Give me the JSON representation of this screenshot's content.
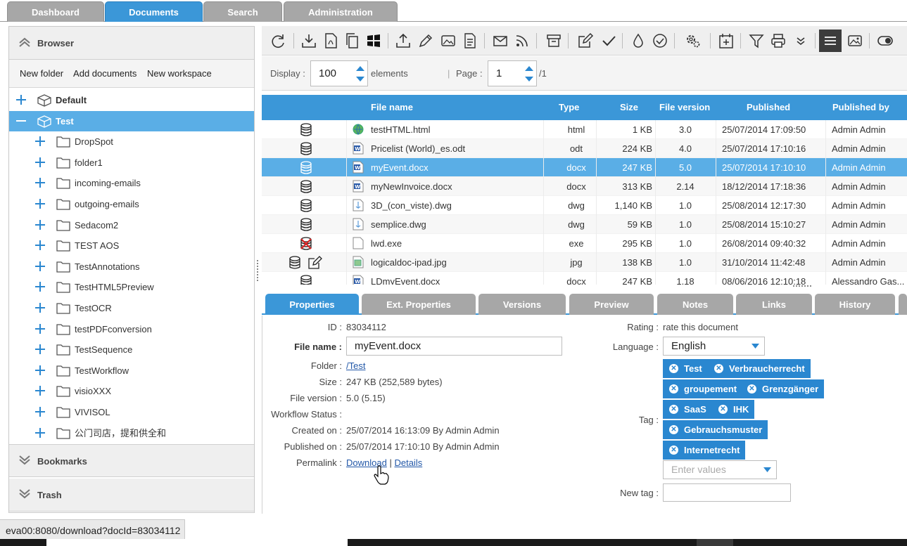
{
  "top_tabs": [
    "Dashboard",
    "Documents",
    "Search",
    "Administration"
  ],
  "left": {
    "browser_title": "Browser",
    "actions": [
      "New folder",
      "Add documents",
      "New workspace"
    ],
    "tree": [
      {
        "label": "Default",
        "level": 0,
        "bold": true
      },
      {
        "label": "Test",
        "level": 0,
        "bold": true,
        "selected": true
      },
      {
        "label": "DropSpot",
        "level": 1
      },
      {
        "label": "folder1",
        "level": 1
      },
      {
        "label": "incoming-emails",
        "level": 1
      },
      {
        "label": "outgoing-emails",
        "level": 1
      },
      {
        "label": "Sedacom2",
        "level": 1
      },
      {
        "label": "TEST AOS",
        "level": 1
      },
      {
        "label": "TestAnnotations",
        "level": 1
      },
      {
        "label": "TestHTML5Preview",
        "level": 1
      },
      {
        "label": "TestOCR",
        "level": 1
      },
      {
        "label": "testPDFconversion",
        "level": 1
      },
      {
        "label": "TestSequence",
        "level": 1
      },
      {
        "label": "TestWorkflow",
        "level": 1
      },
      {
        "label": "visioXXX",
        "level": 1
      },
      {
        "label": "VIVISOL",
        "level": 1
      },
      {
        "label": "公门司店，提和供全和",
        "level": 1
      }
    ],
    "bookmarks_title": "Bookmarks",
    "trash_title": "Trash"
  },
  "display": {
    "label": "Display :",
    "value": "100",
    "elements_label": "elements",
    "page_label": "Page :",
    "page_value": "1",
    "page_total": "/1"
  },
  "grid": {
    "columns": [
      "File name",
      "Type",
      "Size",
      "File version",
      "Published",
      "Published by"
    ],
    "rows": [
      {
        "name": "testHTML.html",
        "type": "html",
        "size": "1 KB",
        "version": "3.0",
        "published": "25/07/2014 17:09:50",
        "by": "Admin Admin",
        "icon": "html-file-icon"
      },
      {
        "name": "Pricelist (World)_es.odt",
        "type": "odt",
        "size": "224 KB",
        "version": "4.0",
        "published": "25/07/2014 17:10:16",
        "by": "Admin Admin",
        "icon": "word-file-icon"
      },
      {
        "name": "myEvent.docx",
        "type": "docx",
        "size": "247 KB",
        "version": "5.0",
        "published": "25/07/2014 17:10:10",
        "by": "Admin Admin",
        "icon": "word-file-icon",
        "selected": true
      },
      {
        "name": "myNewInvoice.docx",
        "type": "docx",
        "size": "313 KB",
        "version": "2.14",
        "published": "18/12/2014 17:18:36",
        "by": "Admin Admin",
        "icon": "word-file-icon"
      },
      {
        "name": "3D_(con_viste).dwg",
        "type": "dwg",
        "size": "1,140 KB",
        "version": "1.0",
        "published": "25/08/2014 12:17:30",
        "by": "Admin Admin",
        "icon": "dwg-file-icon"
      },
      {
        "name": "semplice.dwg",
        "type": "dwg",
        "size": "59 KB",
        "version": "1.0",
        "published": "25/08/2014 15:10:27",
        "by": "Admin Admin",
        "icon": "dwg-file-icon"
      },
      {
        "name": "lwd.exe",
        "type": "exe",
        "size": "295 KB",
        "version": "1.0",
        "published": "26/08/2014 09:40:32",
        "by": "Admin Admin",
        "icon": "generic-file-icon",
        "indexed": false
      },
      {
        "name": "logicaldoc-ipad.jpg",
        "type": "jpg",
        "size": "138 KB",
        "version": "1.0",
        "published": "31/10/2014 11:42:48",
        "by": "Admin Admin",
        "icon": "image-file-icon",
        "edit": true
      },
      {
        "name": "LDmyEvent.docx",
        "type": "docx",
        "size": "247 KB",
        "version": "1.18",
        "published": "08/06/2016 12:10:18",
        "by": "Alessandro Gas...",
        "icon": "word-file-icon"
      }
    ]
  },
  "bottom_tabs": [
    "Properties",
    "Ext. Properties",
    "Versions",
    "Preview",
    "Notes",
    "Links",
    "History"
  ],
  "properties": {
    "id_label": "ID :",
    "id": "83034112",
    "filename_label": "File name :",
    "filename": "myEvent.docx",
    "folder_label": "Folder :",
    "folder": "/Test",
    "size_label": "Size :",
    "size": "247 KB (252,589 bytes)",
    "version_label": "File version :",
    "version": "5.0 (5.15)",
    "workflow_label": "Workflow Status :",
    "created_label": "Created on :",
    "created": "25/07/2014 16:13:09 By Admin Admin",
    "published_label": "Published on :",
    "published": "25/07/2014 17:10:10 By Admin Admin",
    "permalink_label": "Permalink :",
    "download": "Download",
    "sep": "|",
    "details": "Details",
    "rating_label": "Rating :",
    "rating": "rate this document",
    "language_label": "Language :",
    "language": "English",
    "tag_label": "Tag :",
    "tags": [
      "Test",
      "Verbraucherrecht",
      "groupement",
      "Grenzgänger",
      "SaaS",
      "IHK",
      "Gebrauchsmuster",
      "Internetrecht"
    ],
    "enter_values": "Enter values",
    "newtag_label": "New tag :"
  },
  "status_url": "eva00:8080/download?docId=83034112",
  "colors": {
    "accent": "#3b97d8",
    "selected_row": "#5aaee6",
    "tag": "#2a87d0"
  }
}
